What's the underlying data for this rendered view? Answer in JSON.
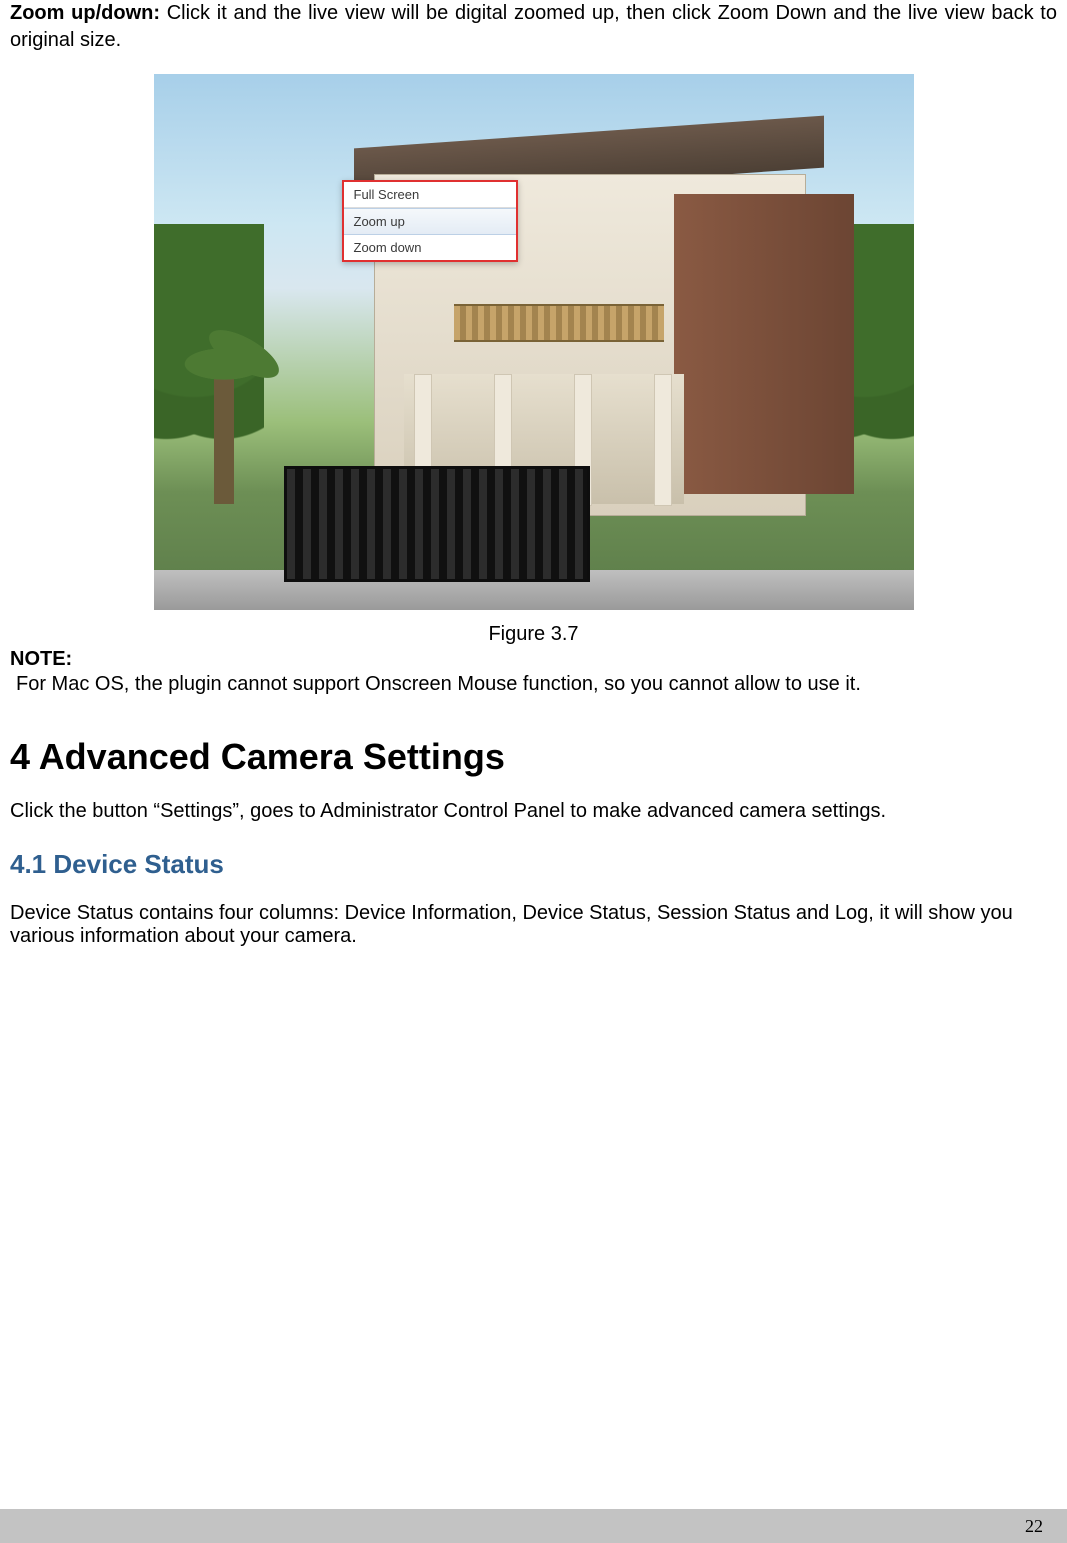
{
  "intro": {
    "bold_label": "Zoom up/down:",
    "rest": " Click it and the live view will be digital zoomed up, then click Zoom Down and the live view back to original size."
  },
  "context_menu": {
    "items": [
      {
        "label": "Full Screen",
        "selected": false
      },
      {
        "label": "Zoom up",
        "selected": true
      },
      {
        "label": "Zoom down",
        "selected": false
      }
    ]
  },
  "figure_caption": "Figure 3.7",
  "note_label": "NOTE:",
  "note_text": "For Mac OS, the plugin cannot support Onscreen Mouse function, so you cannot allow to use it.",
  "section_heading": "4 Advanced Camera Settings",
  "section_body": "Click the button “Settings”, goes to Administrator Control Panel to make advanced camera settings.",
  "subsection_heading": "4.1 Device Status",
  "subsection_body": "Device Status contains four columns: Device Information, Device Status, Session Status and Log, it will show you various information about your camera.",
  "page_number": "22"
}
